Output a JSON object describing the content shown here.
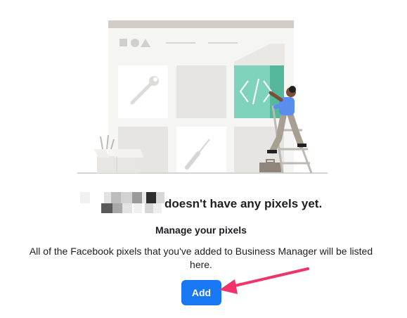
{
  "empty_state": {
    "owner_name_redacted": true,
    "heading_suffix": "doesn't have any pixels yet.",
    "subheading": "Manage your pixels",
    "description": "All of the Facebook pixels that you've added to Business Manager will be listed here.",
    "add_label": "Add"
  },
  "colors": {
    "primary_button": "#1877f2",
    "annotation_arrow": "#f0336a",
    "illustration_accent": "#7fd3bd",
    "illustration_gray": "#e9e9e7"
  },
  "icons": [
    "wrench-icon",
    "screwdriver-icon",
    "code-brackets-icon",
    "toolbox-icon"
  ]
}
